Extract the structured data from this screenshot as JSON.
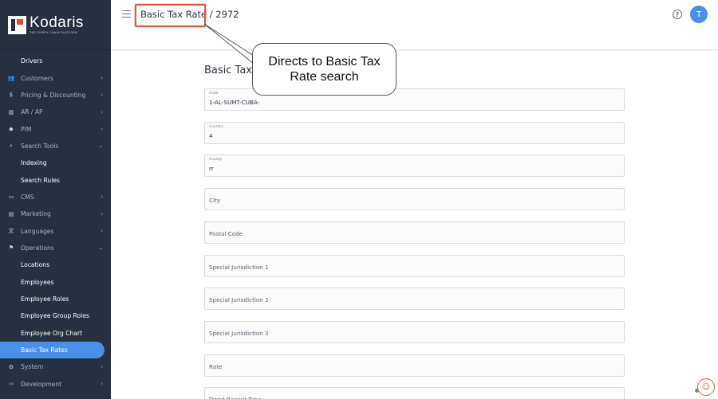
{
  "app": {
    "logo_name": "Kodaris",
    "logo_tagline": "THE SUPPLY CHAIN PLATFORM"
  },
  "header": {
    "breadcrumb": "Basic Tax Rate / 2972",
    "avatar_letter": "T",
    "help_glyph": "?"
  },
  "sidebar": {
    "items": [
      {
        "label": "Drivers",
        "icon": "",
        "type": "sub"
      },
      {
        "label": "Customers",
        "icon": "users-icon",
        "type": "section"
      },
      {
        "label": "Pricing & Discounting",
        "icon": "dollar-icon",
        "type": "section"
      },
      {
        "label": "AR / AP",
        "icon": "bank-icon",
        "type": "section"
      },
      {
        "label": "PIM",
        "icon": "tag-icon",
        "type": "section"
      },
      {
        "label": "Search Tools",
        "icon": "search-icon",
        "type": "section-open"
      },
      {
        "label": "Indexing",
        "icon": "",
        "type": "sub"
      },
      {
        "label": "Search Rules",
        "icon": "",
        "type": "sub"
      },
      {
        "label": "CMS",
        "icon": "cms-icon",
        "type": "section"
      },
      {
        "label": "Marketing",
        "icon": "marketing-icon",
        "type": "section"
      },
      {
        "label": "Languages",
        "icon": "translate-icon",
        "type": "section"
      },
      {
        "label": "Operations",
        "icon": "operations-icon",
        "type": "section-open"
      },
      {
        "label": "Locations",
        "icon": "",
        "type": "sub"
      },
      {
        "label": "Employees",
        "icon": "",
        "type": "sub"
      },
      {
        "label": "Employee Roles",
        "icon": "",
        "type": "sub"
      },
      {
        "label": "Employee Group Roles",
        "icon": "",
        "type": "sub"
      },
      {
        "label": "Employee Org Chart",
        "icon": "",
        "type": "sub"
      },
      {
        "label": "Basic Tax Rates",
        "icon": "",
        "type": "sub-active"
      },
      {
        "label": "System",
        "icon": "gear-icon",
        "type": "section"
      },
      {
        "label": "Development",
        "icon": "code-icon",
        "type": "section"
      }
    ]
  },
  "form": {
    "title": "Basic Tax",
    "fields": [
      {
        "label": "Code",
        "value": "1-AL-SUMT-CUBA-"
      },
      {
        "label": "Country",
        "value": "4"
      },
      {
        "label": "County",
        "value": "rr"
      },
      {
        "label": "",
        "placeholder": "City"
      },
      {
        "label": "",
        "placeholder": "Postal Code"
      },
      {
        "label": "",
        "placeholder": "Special Jurisdiction 1"
      },
      {
        "label": "",
        "placeholder": "Special Jurisdiction 2"
      },
      {
        "label": "",
        "placeholder": "Special Jurisdiction 3"
      },
      {
        "label": "",
        "placeholder": "Rate"
      },
      {
        "label": "",
        "placeholder": "Trend Record Type"
      }
    ]
  },
  "callout": {
    "text": "Directs to Basic Tax Rate search"
  }
}
